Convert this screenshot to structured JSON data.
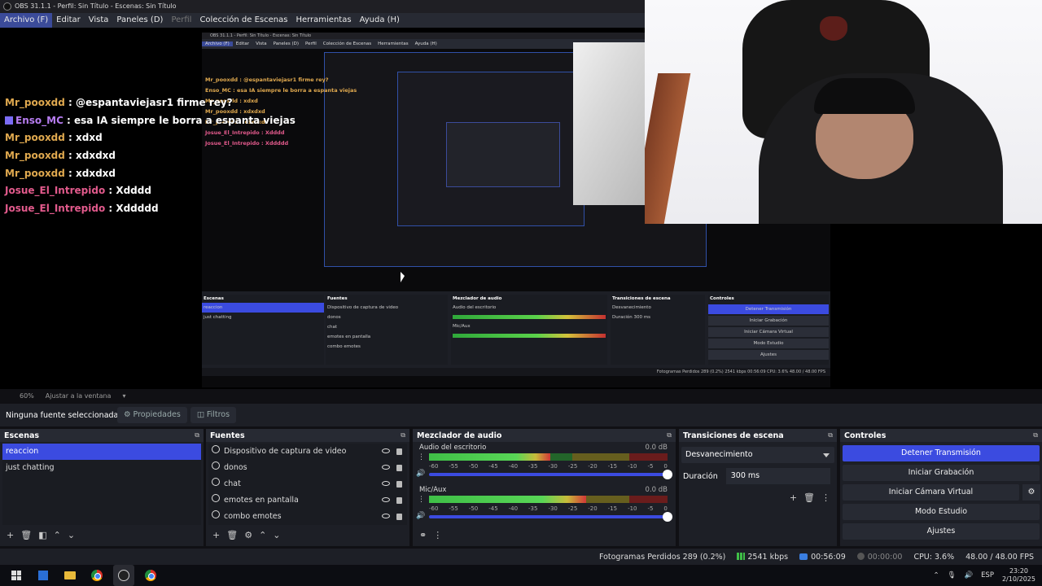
{
  "titlebar": {
    "title": "OBS 31.1.1 - Perfil: Sin Título - Escenas: Sin Título"
  },
  "menubar": {
    "items": [
      "Archivo (F)",
      "Editar",
      "Vista",
      "Paneles (D)",
      "Perfil",
      "Colección de Escenas",
      "Herramientas",
      "Ayuda (H)"
    ]
  },
  "chat": {
    "messages": [
      {
        "user": "Mr_pooxdd",
        "text": " : @espantaviejasr1 firme rey?",
        "color": "#e0a94f"
      },
      {
        "user": "Enso_MC",
        "text": " : esa IA siempre le borra a espanta viejas",
        "color": "#b67cf0"
      },
      {
        "user": "Mr_pooxdd",
        "text": " : xdxd",
        "color": "#e0a94f"
      },
      {
        "user": "Mr_pooxdd",
        "text": " : xdxdxd",
        "color": "#e0a94f"
      },
      {
        "user": "Mr_pooxdd",
        "text": " : xdxdxd",
        "color": "#e0a94f"
      },
      {
        "user": "Josue_El_Intrepido",
        "text": " : Xdddd",
        "color": "#e25a8c"
      },
      {
        "user": "Josue_El_Intrepido",
        "text": " : Xddddd",
        "color": "#e25a8c"
      }
    ]
  },
  "nested": {
    "title": "OBS 31.1.1 - Perfil: Sin Título - Escenas: Sin Título",
    "menu": [
      "Archivo (F)",
      "Editar",
      "Vista",
      "Paneles (D)",
      "Perfil",
      "Colección de Escenas",
      "Herramientas",
      "Ayuda (H)"
    ],
    "chat": [
      {
        "text": "Mr_pooxdd : @espantaviejasr1 firme rey?",
        "pink": false
      },
      {
        "text": "Enso_MC : esa IA siempre le borra a espanta viejas",
        "pink": false
      },
      {
        "text": "Mr_pooxdd : xdxd",
        "pink": false
      },
      {
        "text": "Mr_pooxdd : xdxdxd",
        "pink": false
      },
      {
        "text": "Mr_pooxdd : xdxdxd",
        "pink": false
      },
      {
        "text": "Josue_El_Intrepido : Xdddd",
        "pink": true
      },
      {
        "text": "Josue_El_Intrepido : Xddddd",
        "pink": true
      }
    ],
    "zoom": "60%",
    "fit": "Ajustar a la ventana",
    "no_source": "Ninguna fuente seleccionada",
    "props": "Propiedades",
    "filters": "Filtros",
    "scenes_title": "Escenas",
    "scenes": [
      "reaccion",
      "just chatting"
    ],
    "sources_title": "Fuentes",
    "sources": [
      "Dispositivo de captura de video",
      "donos",
      "chat",
      "emotes en pantalla",
      "combo emotes"
    ],
    "mixer_title": "Mezclador de audio",
    "desk_audio": "Audio del escritorio",
    "mic": "Mic/Aux",
    "trans_title": "Transiciones de escena",
    "fade": "Desvanecimiento",
    "dur_label": "Duración",
    "dur_value": "300 ms",
    "controls_title": "Controles",
    "controls": [
      "Detener Transmisión",
      "Iniciar Grabación",
      "Iniciar Cámara Virtual",
      "Modo Estudio",
      "Ajustes"
    ],
    "status": "Fotogramas Perdidos 289 (0.2%)   2541 kbps   00:56:09   CPU: 3.6%   48.00 / 48.00 FPS",
    "tb_clock_time": "23:20",
    "tb_clock_date": "2/10/2025",
    "lang": "ESP"
  },
  "statusline": {
    "zoom": "60%",
    "fit": "Ajustar a la ventana"
  },
  "propbar": {
    "no_source": "Ninguna fuente seleccionada",
    "properties": "Propiedades",
    "filters": "Filtros"
  },
  "scenes": {
    "title": "Escenas",
    "items": [
      "reaccion",
      "just chatting"
    ],
    "selected": 0
  },
  "sources": {
    "title": "Fuentes",
    "items": [
      "Dispositivo de captura de video",
      "donos",
      "chat",
      "emotes en pantalla",
      "combo emotes"
    ]
  },
  "mixer": {
    "title": "Mezclador de audio",
    "channels": [
      {
        "name": "Audio del escritorio",
        "db": "0.0 dB",
        "level": 0.51
      },
      {
        "name": "Mic/Aux",
        "db": "0.0 dB",
        "level": 0.66
      }
    ],
    "ticks": [
      "-60",
      "-55",
      "-50",
      "-45",
      "-40",
      "-35",
      "-30",
      "-25",
      "-20",
      "-15",
      "-10",
      "-5",
      "0"
    ]
  },
  "transitions": {
    "title": "Transiciones de escena",
    "type": "Desvanecimiento",
    "duration_label": "Duración",
    "duration_value": "300 ms"
  },
  "controls": {
    "title": "Controles",
    "stop_stream": "Detener Transmisión",
    "start_recording": "Iniciar Grabación",
    "virtual_cam": "Iniciar Cámara Virtual",
    "studio_mode": "Modo Estudio",
    "settings": "Ajustes"
  },
  "status": {
    "dropped": "Fotogramas Perdidos 289 (0.2%)",
    "bitrate": "2541 kbps",
    "stream_time": "00:56:09",
    "rec_time": "00:00:00",
    "cpu": "CPU: 3.6%",
    "fps": "48.00 / 48.00 FPS"
  },
  "taskbar": {
    "lang": "ESP",
    "time": "23:20",
    "date": "2/10/2025"
  },
  "colors": {
    "accent": "#3b4be0",
    "panel": "#1d1f26",
    "header": "#272a33"
  }
}
